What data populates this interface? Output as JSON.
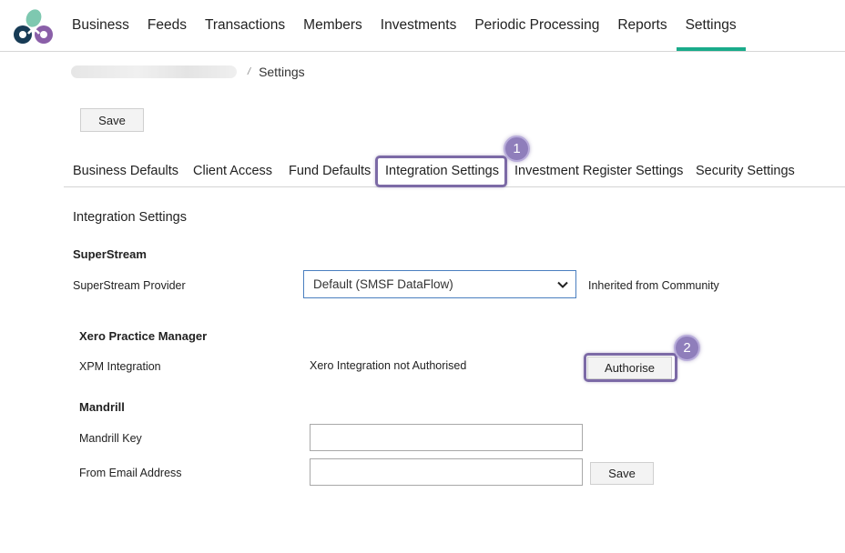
{
  "nav": {
    "items": [
      {
        "label": "Business"
      },
      {
        "label": "Feeds"
      },
      {
        "label": "Transactions"
      },
      {
        "label": "Members"
      },
      {
        "label": "Investments"
      },
      {
        "label": "Periodic Processing"
      },
      {
        "label": "Reports"
      },
      {
        "label": "Settings",
        "active": true
      }
    ]
  },
  "breadcrumb": {
    "separator": "/",
    "current": "Settings"
  },
  "toolbar": {
    "save_label": "Save"
  },
  "tabs": [
    {
      "label": "Business Defaults"
    },
    {
      "label": "Client Access"
    },
    {
      "label": "Fund Defaults"
    },
    {
      "label": "Integration Settings",
      "active": true
    },
    {
      "label": "Investment Register Settings"
    },
    {
      "label": "Security Settings"
    }
  ],
  "markers": {
    "step1": "1",
    "step2": "2"
  },
  "integration": {
    "title": "Integration Settings",
    "superstream": {
      "heading": "SuperStream",
      "provider_label": "SuperStream Provider",
      "provider_value": "Default (SMSF DataFlow)",
      "inherited_note": "Inherited from Community"
    },
    "xero": {
      "heading": "Xero Practice Manager",
      "xpm_label": "XPM Integration",
      "status": "Xero Integration not Authorised",
      "authorise_label": "Authorise"
    },
    "mandrill": {
      "heading": "Mandrill",
      "key_label": "Mandrill Key",
      "key_value": "",
      "from_email_label": "From Email Address",
      "from_email_value": "",
      "save_label": "Save"
    }
  },
  "colors": {
    "accent_green": "#1aab8a",
    "highlight_purple": "#7c6aa6",
    "badge_purple": "#8f7ebb",
    "select_border": "#4a7fbf"
  }
}
